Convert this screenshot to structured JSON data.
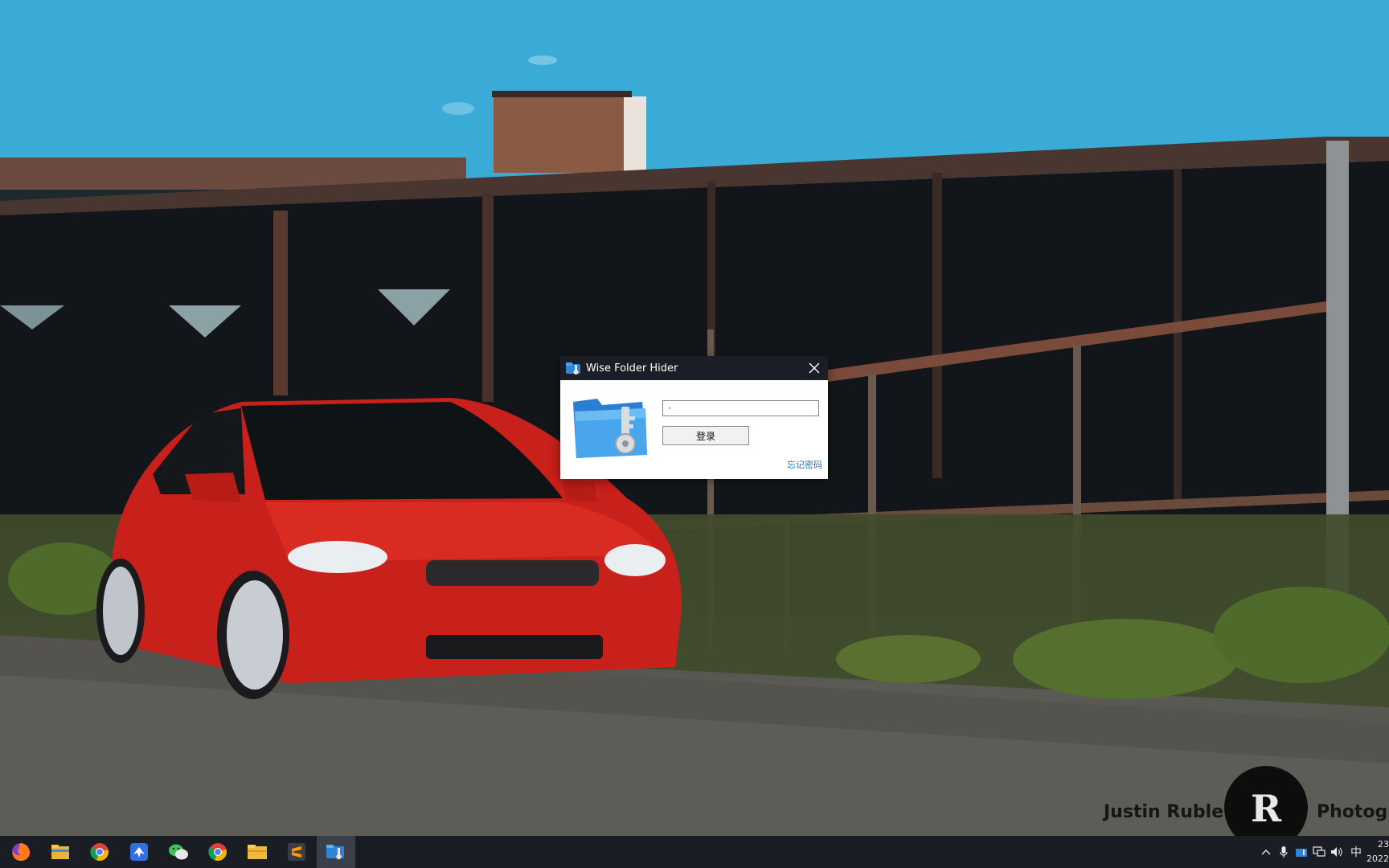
{
  "dialog": {
    "title": "Wise Folder Hider",
    "password_value": "·",
    "login_label": "登录",
    "forgot_label": "忘记密码"
  },
  "watermark": {
    "name": "Justin Ruble",
    "suffix": "Photogr"
  },
  "taskbar": {
    "apps": [
      "firefox-icon",
      "file-explorer-icon",
      "chrome-icon",
      "feishu-icon",
      "wechat-icon",
      "chrome-icon",
      "folder-icon",
      "sublime-text-icon",
      "wise-folder-hider-icon"
    ],
    "tray": {
      "ime_label": "中",
      "time": "23",
      "date": "2022"
    }
  }
}
